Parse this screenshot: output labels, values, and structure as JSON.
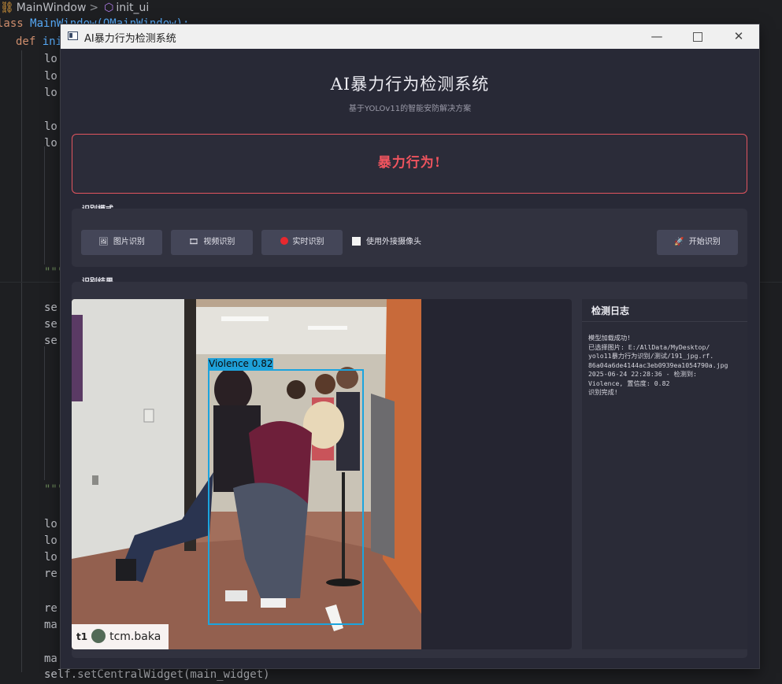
{
  "ide": {
    "breadcrumb": {
      "class_name": "MainWindow",
      "separator": ">",
      "method_name": "init_ui"
    },
    "code_fragments": {
      "line_class": "lass MainWindow(QMainWindow):",
      "line_def": "def ini",
      "log_prefix": "lo",
      "self_prefix": "se",
      "res_prefix": "re",
      "ma_prefix": "ma",
      "docstring_marker": "\"\"\"",
      "last_line": "self.setCentralWidget(main_widget)"
    }
  },
  "app": {
    "window_title": "AI暴力行为检测系统",
    "controls": {
      "minimize": "—",
      "close": "✕"
    },
    "header": {
      "title": "AI暴力行为检测系统",
      "subtitle": "基于YOLOv11的智能安防解决方案"
    },
    "alert": {
      "text": "暴力行为!",
      "color": "#f0545e"
    },
    "mode_group": {
      "label": "识别模式",
      "buttons": {
        "image": {
          "icon": "🖼",
          "label": "图片识别"
        },
        "video": {
          "icon": "🎞",
          "label": "视频识别"
        },
        "live": {
          "label": "实时识别"
        },
        "start": {
          "icon": "🚀",
          "label": "开始识别"
        }
      },
      "external_camera": {
        "label": "使用外接摄像头",
        "checked": false
      }
    },
    "result_group": {
      "label": "识别结果",
      "detection": {
        "class": "Violence",
        "confidence": "0.82",
        "box_color": "#1ba4de"
      },
      "watermark": {
        "icon": "t1",
        "handle": "tcm.baka"
      }
    },
    "log": {
      "title": "检测日志",
      "lines": [
        "模型加载成功!",
        "已选择图片: E:/AllData/MyDesktop/",
        "yolo11暴力行为识别/测试/191_jpg.rf.",
        "86a04a6de4144ac3eb0939ea1054790a.jpg",
        "2025-06-24 22:28:36 - 检测到:",
        "Violence, 置信度: 0.82",
        "识别完成!"
      ]
    }
  }
}
